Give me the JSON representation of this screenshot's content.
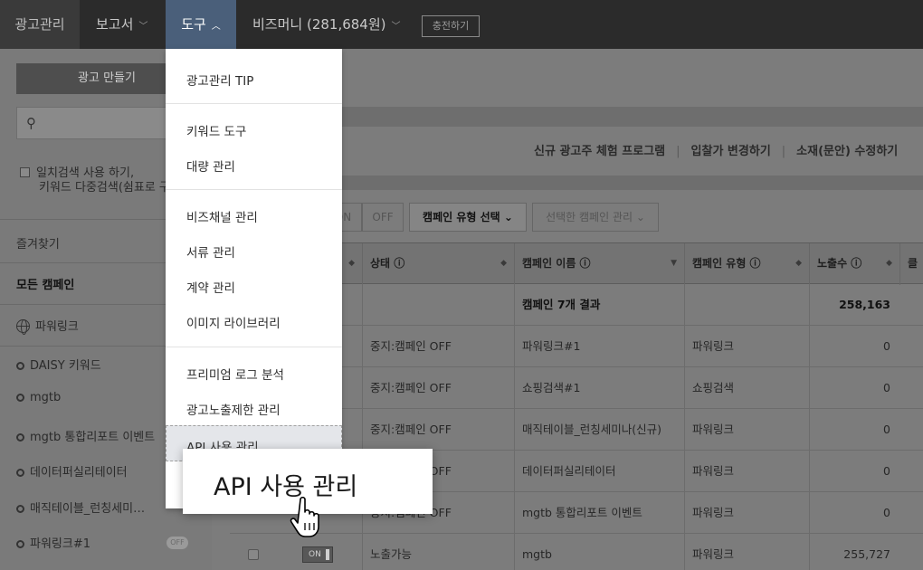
{
  "nav": {
    "ad_manage": "광고관리",
    "report": "보고서",
    "tools": "도구",
    "bizmoney": "비즈머니 (281,684원)",
    "charge": "충전하기"
  },
  "sidebar": {
    "create_ad": "광고 만들기",
    "exact_search_line1": "일치검색 사용 하기,",
    "exact_search_line2": "키워드 다중검색(쉼표로 구",
    "favorites": "즐겨찾기",
    "all_campaigns": "모든 캠페인",
    "powerlink": "파워링크",
    "campaigns": [
      {
        "label": "DAISY 키워드"
      },
      {
        "label": "mgtb"
      },
      {
        "label": "mgtb 통합리포트 이벤트"
      },
      {
        "label": "데이터퍼실리테이터"
      },
      {
        "label": "매직테이블_런칭세미…"
      },
      {
        "label": "파워링크#1",
        "badge": "OFF"
      }
    ]
  },
  "main": {
    "links": [
      "신규 광고주 체험 프로그램",
      "입찰가 변경하기",
      "소재(문안) 수정하기"
    ],
    "toolbar": {
      "on": "ON",
      "off": "OFF",
      "campaign_type": "캠페인 유형 선택",
      "manage_selected": "선택한 캠페인 관리"
    }
  },
  "table": {
    "headers": [
      "상태 ⓘ",
      "캠페인 이름 ⓘ",
      "캠페인 유형 ⓘ",
      "노출수 ⓘ",
      "클"
    ],
    "summary": {
      "name": "캠페인 7개 결과",
      "impressions": "258,163"
    },
    "rows": [
      {
        "status": "중지:캠페인 OFF",
        "name": "파워링크#1",
        "type": "파워링크",
        "impressions": "0"
      },
      {
        "status": "중지:캠페인 OFF",
        "name": "쇼핑검색#1",
        "type": "쇼핑검색",
        "impressions": "0"
      },
      {
        "status": "중지:캠페인 OFF",
        "name": "매직테이블_런칭세미나(신규)",
        "type": "파워링크",
        "impressions": "0"
      },
      {
        "status": "중지:캠페인 OFF",
        "name": "데이터퍼실리테이터",
        "type": "파워링크",
        "impressions": "0"
      },
      {
        "status": "중지:캠페인 OFF",
        "name": "mgtb 통합리포트 이벤트",
        "type": "파워링크",
        "impressions": "0"
      },
      {
        "status": "노출가능",
        "name": "mgtb",
        "type": "파워링크",
        "impressions": "255,727",
        "toggle": "ON"
      }
    ]
  },
  "dropdown": {
    "items": [
      "광고관리 TIP",
      "키워드 도구",
      "대량 관리",
      "비즈채널 관리",
      "서류 관리",
      "계약 관리",
      "이미지 라이브러리",
      "프리미엄 로그 분석",
      "광고노출제한 관리",
      "API 사용 관리"
    ]
  },
  "callout": {
    "label": "API 사용 관리"
  }
}
